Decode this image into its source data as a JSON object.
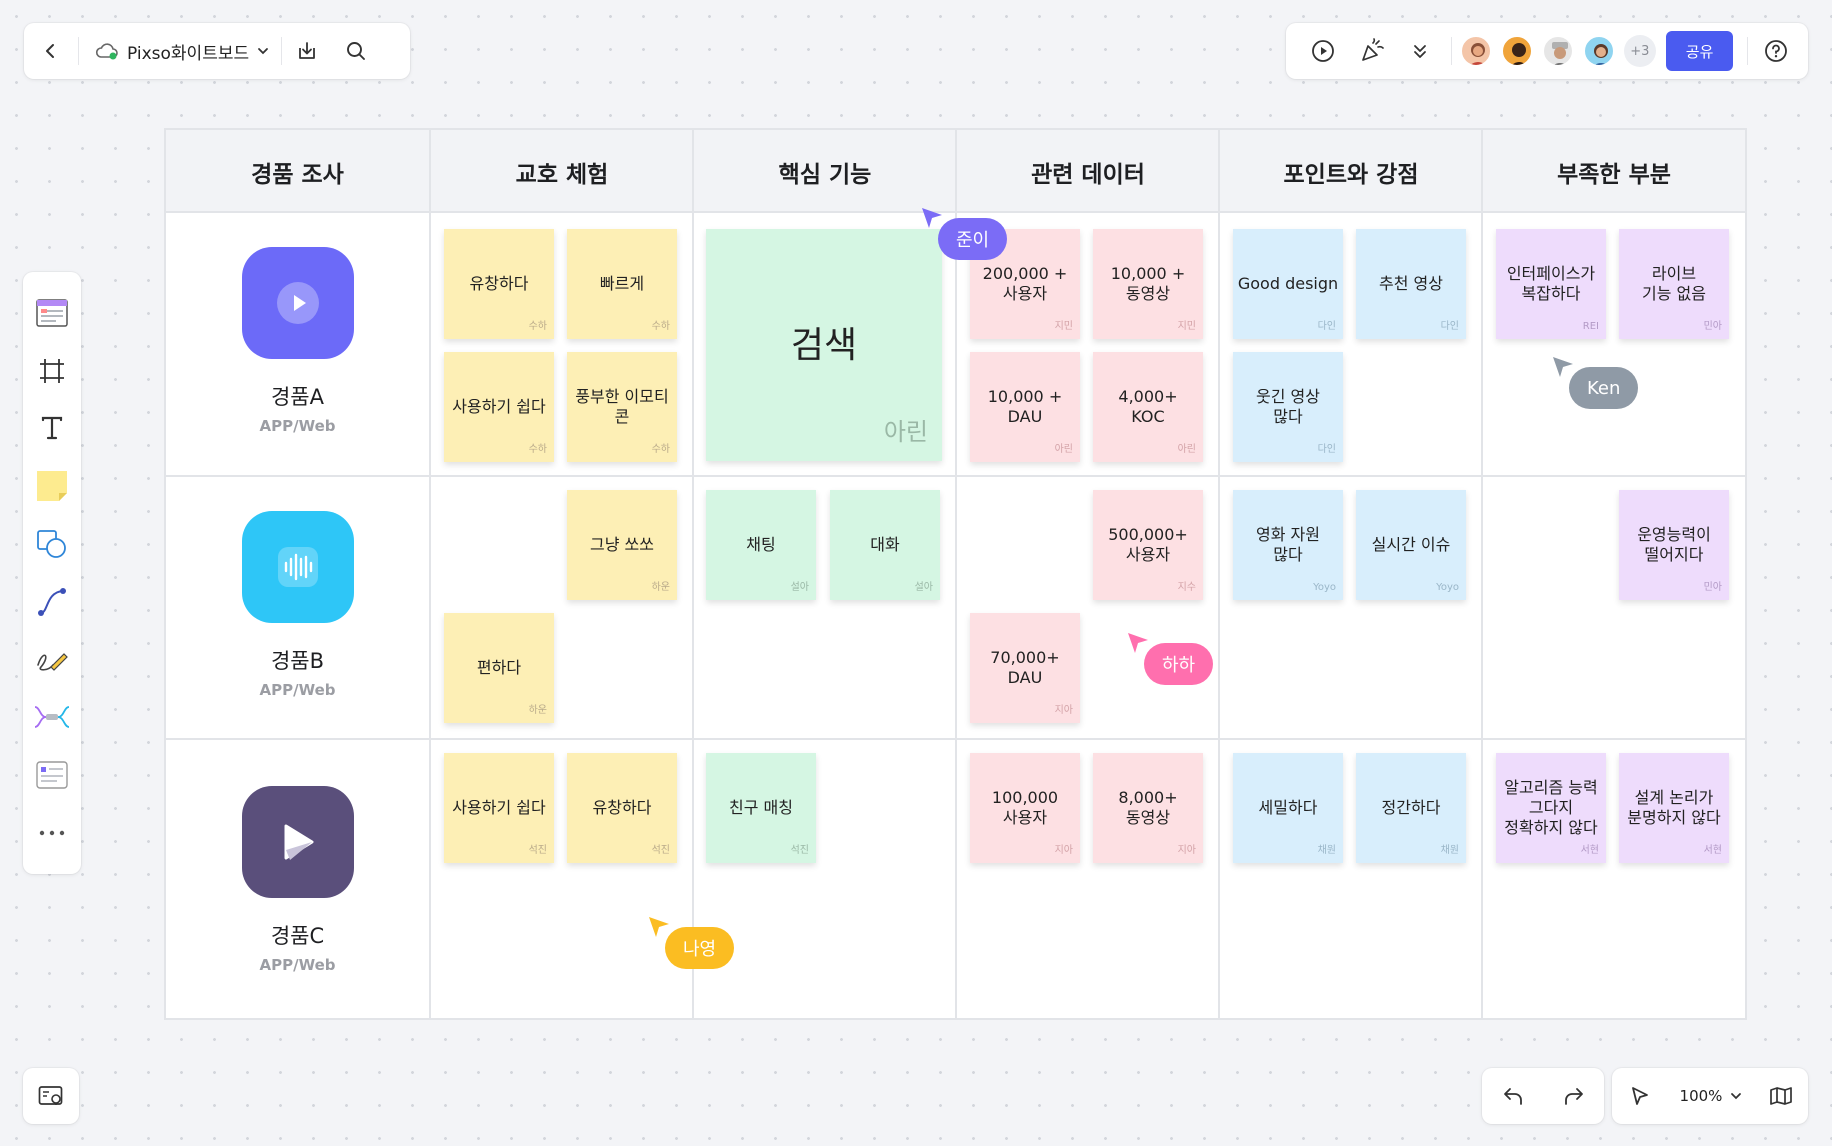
{
  "app": {
    "file_title": "Pixso화이트보드"
  },
  "toolbar": {
    "more_collaborators": "+3",
    "share_label": "공유"
  },
  "zoom": {
    "level": "100%"
  },
  "table": {
    "headers": [
      "경품 조사",
      "교호 체험",
      "핵심 기능",
      "관련 데이터",
      "포인트와 강점",
      "부족한 부분"
    ],
    "competitors": [
      {
        "name": "경품A",
        "platform": "APP/Web",
        "color": "#6c6af8"
      },
      {
        "name": "경품B",
        "platform": "APP/Web",
        "color": "#2ec6f7"
      },
      {
        "name": "경품C",
        "platform": "APP/Web",
        "color": "#5a4f7b"
      }
    ]
  },
  "notes": [
    {
      "text": "유창하다",
      "author": "수하",
      "color": "yellow"
    },
    {
      "text": "빠르게",
      "author": "수하",
      "color": "yellow"
    },
    {
      "text": "사용하기 쉽다",
      "author": "수하",
      "color": "yellow"
    },
    {
      "text": "풍부한 이모티콘",
      "author": "수하",
      "color": "yellow"
    },
    {
      "text": "검색",
      "author": "아린",
      "color": "green"
    },
    {
      "text": "200,000 +\n사용자",
      "author": "지민",
      "color": "pink"
    },
    {
      "text": "10,000 +\n동영상",
      "author": "지민",
      "color": "pink"
    },
    {
      "text": "10,000 +\nDAU",
      "author": "아린",
      "color": "pink"
    },
    {
      "text": "4,000+\nKOC",
      "author": "아린",
      "color": "pink"
    },
    {
      "text": "Good design",
      "author": "다인",
      "color": "blue"
    },
    {
      "text": "추천 영상",
      "author": "다인",
      "color": "blue"
    },
    {
      "text": "웃긴 영상\n많다",
      "author": "다인",
      "color": "blue"
    },
    {
      "text": "인터페이스가\n복잡하다",
      "author": "REI",
      "color": "purple"
    },
    {
      "text": "라이브\n기능 없음",
      "author": "민아",
      "color": "purple"
    },
    {
      "text": "그냥 쏘쏘",
      "author": "하운",
      "color": "yellow"
    },
    {
      "text": "편하다",
      "author": "하운",
      "color": "yellow"
    },
    {
      "text": "채팅",
      "author": "설아",
      "color": "green"
    },
    {
      "text": "대화",
      "author": "설아",
      "color": "green"
    },
    {
      "text": "500,000+\n사용자",
      "author": "지수",
      "color": "pink"
    },
    {
      "text": "70,000+\nDAU",
      "author": "지아",
      "color": "pink"
    },
    {
      "text": "영화 자원\n많다",
      "author": "Yoyo",
      "color": "blue"
    },
    {
      "text": "실시간 이슈",
      "author": "Yoyo",
      "color": "blue"
    },
    {
      "text": "운영능력이\n떨어지다",
      "author": "민아",
      "color": "purple"
    },
    {
      "text": "사용하기 쉽다",
      "author": "석진",
      "color": "yellow"
    },
    {
      "text": "유창하다",
      "author": "석진",
      "color": "yellow"
    },
    {
      "text": "친구 매칭",
      "author": "석진",
      "color": "green"
    },
    {
      "text": "100,000\n사용자",
      "author": "지아",
      "color": "pink"
    },
    {
      "text": "8,000+\n동영상",
      "author": "지아",
      "color": "pink"
    },
    {
      "text": "세밀하다",
      "author": "채원",
      "color": "blue"
    },
    {
      "text": "정간하다",
      "author": "채원",
      "color": "blue"
    },
    {
      "text": "알고리즘 능력\n그다지\n정확하지 않다",
      "author": "서현",
      "color": "purple"
    },
    {
      "text": "설계 논리가\n분명하지 않다",
      "author": "서현",
      "color": "purple"
    }
  ],
  "cursors": [
    {
      "name": "준이",
      "color": "#7b6cf6"
    },
    {
      "name": "Ken",
      "color": "#8f9aa6"
    },
    {
      "name": "하하",
      "color": "#ff6fae"
    },
    {
      "name": "나영",
      "color": "#fbbd22"
    }
  ]
}
